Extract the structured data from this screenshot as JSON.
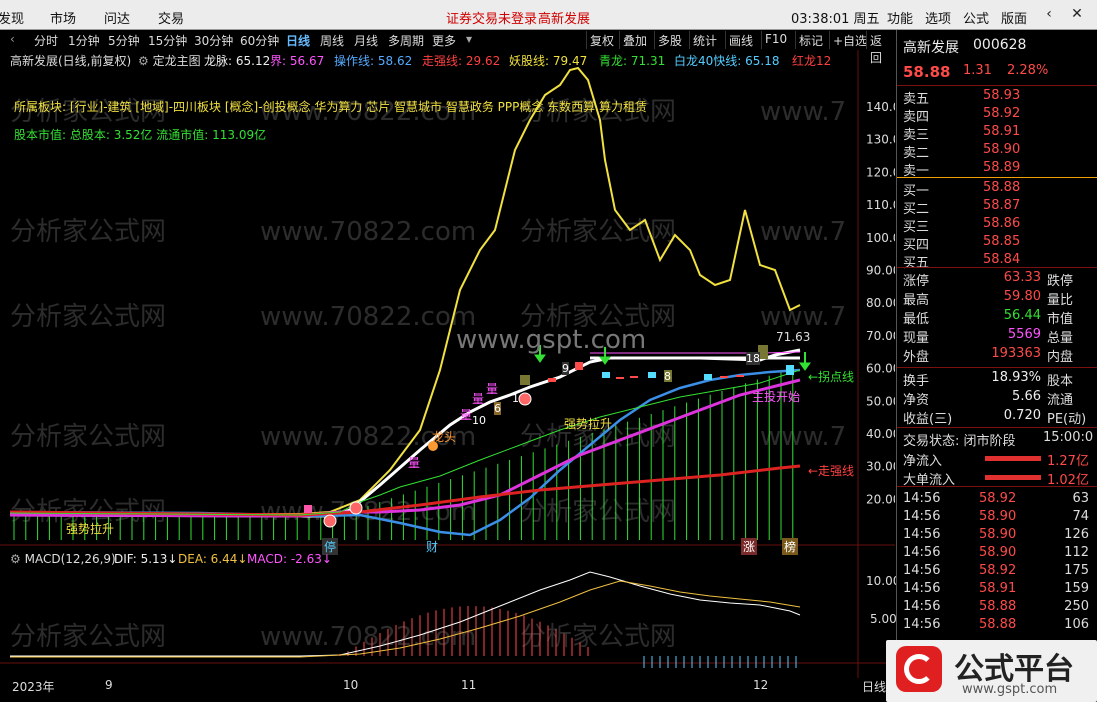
{
  "menubar": {
    "items": [
      "发现",
      "市场",
      "问达",
      "交易"
    ],
    "notice": [
      "证券交易未登录",
      "高新发展"
    ],
    "clock": "03:38:01 周五",
    "right_items": [
      "功能",
      "选项",
      "公式",
      "版面"
    ],
    "back_icon": "chevron-left-icon",
    "close_icon": "close-icon"
  },
  "toolbar": {
    "periods": [
      "分时",
      "1分钟",
      "5分钟",
      "15分钟",
      "30分钟",
      "60分钟",
      "日线",
      "周线",
      "月线",
      "多周期",
      "更多"
    ],
    "active_period": "日线",
    "right_buttons": [
      "复权",
      "叠加",
      "多股",
      "统计",
      "画线",
      "F10",
      "标记",
      "+自选",
      "返回"
    ]
  },
  "chart": {
    "title_row": [
      {
        "text": "高新发展(日线,前复权)",
        "color": "#dddddd"
      },
      {
        "text": "定龙主图",
        "color": "#dddddd"
      },
      {
        "text": "龙脉: 65.12",
        "color": "#eeeeee"
      },
      {
        "text": "界: 56.67",
        "color": "#ff55ff"
      },
      {
        "text": "操作线: 58.62",
        "color": "#55aaff"
      },
      {
        "text": "走强线: 29.62",
        "color": "#ff4040"
      },
      {
        "text": "妖股线: 79.47",
        "color": "#f0e040"
      },
      {
        "text": "青龙: 71.31",
        "color": "#33e033"
      },
      {
        "text": "白龙40快线: 65.18",
        "color": "#55ccff"
      },
      {
        "text": "红龙12",
        "color": "#ff4040"
      }
    ],
    "sector_text": "所属板块: [行业]-建筑 [地域]-四川板块 [概念]-创投概念 华为算力 芯片 智慧城市 智慧政务 PPP概念 东数西算 算力租赁",
    "market_value_text": "股本市值: 总股本: 3.52亿 流通市值: 113.09亿",
    "watermark": "www.gspt.com",
    "watermark_bg": "分析家公式网 www.70822.com",
    "price_axis": [
      "140.0",
      "130.0",
      "120.0",
      "110.0",
      "100.0",
      "90.00",
      "80.00",
      "70.00",
      "60.00",
      "50.00",
      "40.00",
      "30.00",
      "20.00"
    ],
    "annotations": {
      "qiangshi_lasheng_1": "强势拉升",
      "qiangshi_lasheng_2": "强势拉升",
      "tingzhi": "停",
      "cai": "财",
      "zhang": "涨",
      "bang": "榜",
      "guaidian": "←拐点线",
      "zouqiang": "←走强线",
      "peak": "71.63",
      "jitou_kaishi": "主投开始",
      "long_mai": "龙头",
      "liang": [
        "量",
        "量",
        "量",
        "量"
      ],
      "numbers": [
        "10",
        "6",
        "1",
        "9",
        "18",
        "8"
      ]
    },
    "macd": {
      "title": "MACD(12,26,9)",
      "dif": "DIF: 5.13↓",
      "dea": "DEA: 6.44↓",
      "macd": "MACD: -2.63↓",
      "axis": [
        "10.00",
        "5.00"
      ]
    },
    "date_axis": [
      "2023年",
      "9",
      "10",
      "11",
      "12"
    ],
    "period_label": "日线",
    "colors": {
      "up": "#ff4a4a",
      "down": "#33e033",
      "yellow": "#f0e040",
      "blue": "#3b8fe6",
      "magenta": "#dd33dd",
      "white": "#ffffff"
    }
  },
  "stock": {
    "name": "高新发展",
    "code": "000628",
    "price": "58.88",
    "change": "1.31",
    "change_pct": "2.28%",
    "asks": [
      {
        "label": "卖五",
        "price": "58.93"
      },
      {
        "label": "卖四",
        "price": "58.92"
      },
      {
        "label": "卖三",
        "price": "58.91"
      },
      {
        "label": "卖二",
        "price": "58.90"
      },
      {
        "label": "卖一",
        "price": "58.89"
      }
    ],
    "bids": [
      {
        "label": "买一",
        "price": "58.88"
      },
      {
        "label": "买二",
        "price": "58.87"
      },
      {
        "label": "买三",
        "price": "58.86"
      },
      {
        "label": "买四",
        "price": "58.85"
      },
      {
        "label": "买五",
        "price": "58.84"
      }
    ],
    "stats": [
      {
        "l": "涨停",
        "v": "63.33",
        "vc": "red",
        "r": "跌停"
      },
      {
        "l": "最高",
        "v": "59.80",
        "vc": "red",
        "r": "量比"
      },
      {
        "l": "最低",
        "v": "56.44",
        "vc": "green",
        "r": "市值"
      },
      {
        "l": "现量",
        "v": "5569",
        "vc": "mag",
        "r": "总量"
      },
      {
        "l": "外盘",
        "v": "193363",
        "vc": "red",
        "r": "内盘"
      }
    ],
    "stats2": [
      {
        "l": "换手",
        "v": "18.93%",
        "vc": "wh",
        "r": "股本"
      },
      {
        "l": "净资",
        "v": "5.66",
        "vc": "wh",
        "r": "流通"
      },
      {
        "l": "收益(三)",
        "v": "0.720",
        "vc": "wh",
        "r": "PE(动)"
      }
    ],
    "trade_status": {
      "label": "交易状态: 闭市阶段",
      "time": "15:00:0"
    },
    "flows": [
      {
        "label": "净流入",
        "value": "1.27亿"
      },
      {
        "label": "大单流入",
        "value": "1.02亿"
      }
    ],
    "ticks": [
      {
        "t": "14:56",
        "p": "58.92",
        "v": "63"
      },
      {
        "t": "14:56",
        "p": "58.90",
        "v": "74"
      },
      {
        "t": "14:56",
        "p": "58.90",
        "v": "126"
      },
      {
        "t": "14:56",
        "p": "58.90",
        "v": "112"
      },
      {
        "t": "14:56",
        "p": "58.92",
        "v": "175"
      },
      {
        "t": "14:56",
        "p": "58.91",
        "v": "159"
      },
      {
        "t": "14:56",
        "p": "58.88",
        "v": "250"
      },
      {
        "t": "14:56",
        "p": "58.88",
        "v": "106"
      }
    ]
  },
  "badge": {
    "title": "公式平台",
    "url": "www.gspt.com"
  }
}
